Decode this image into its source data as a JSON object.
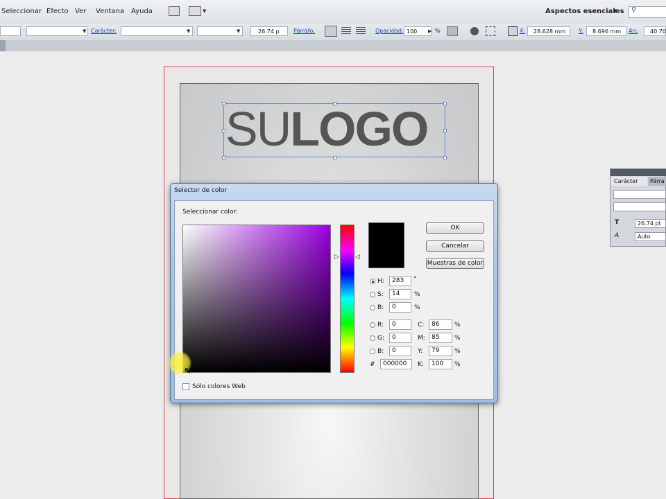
{
  "menu": {
    "items": [
      "Seleccionar",
      "Efecto",
      "Ver",
      "Ventana",
      "Ayuda"
    ],
    "workspace": "Aspectos esenciales"
  },
  "control_bar": {
    "character_label": "Carácter:",
    "font_size": "26.74 p",
    "paragraph_label": "Párrafo:",
    "opacity_label": "Opacidad:",
    "opacity_value": "100",
    "opacity_unit": "%",
    "x_label": "X:",
    "x_value": "28.628 mm",
    "y_label": "Y:",
    "y_value": "8.696 mm",
    "w_label": "An:",
    "w_value": "40.70"
  },
  "artboard": {
    "logo_light": "SU",
    "logo_bold": "LOGO"
  },
  "character_panel": {
    "tab_character": "Carácter",
    "tab_paragraph": "Párra",
    "font_size": "26.74 pt",
    "tracking": "Auto"
  },
  "color_picker": {
    "title": "Selector de color",
    "select_label": "Seleccionar color:",
    "ok": "OK",
    "cancel": "Cancelar",
    "swatches": "Muestras de color",
    "h_label": "H:",
    "h_value": "283",
    "h_unit": "°",
    "s_label": "S:",
    "s_value": "14",
    "s_unit": "%",
    "b_label": "B:",
    "b_value": "0",
    "b_unit": "%",
    "r_label": "R:",
    "r_value": "0",
    "g_label": "G:",
    "g_value": "0",
    "bl_label": "B:",
    "bl_value": "0",
    "c_label": "C:",
    "c_value": "86",
    "m_label": "M:",
    "m_value": "85",
    "y_label": "Y:",
    "y_value": "79",
    "k_label": "K:",
    "k_value": "100",
    "hex_label": "#",
    "hex_value": "000000",
    "cmyk_unit": "%",
    "web_only": "Sólo colores Web",
    "selected_color": "#000000"
  }
}
